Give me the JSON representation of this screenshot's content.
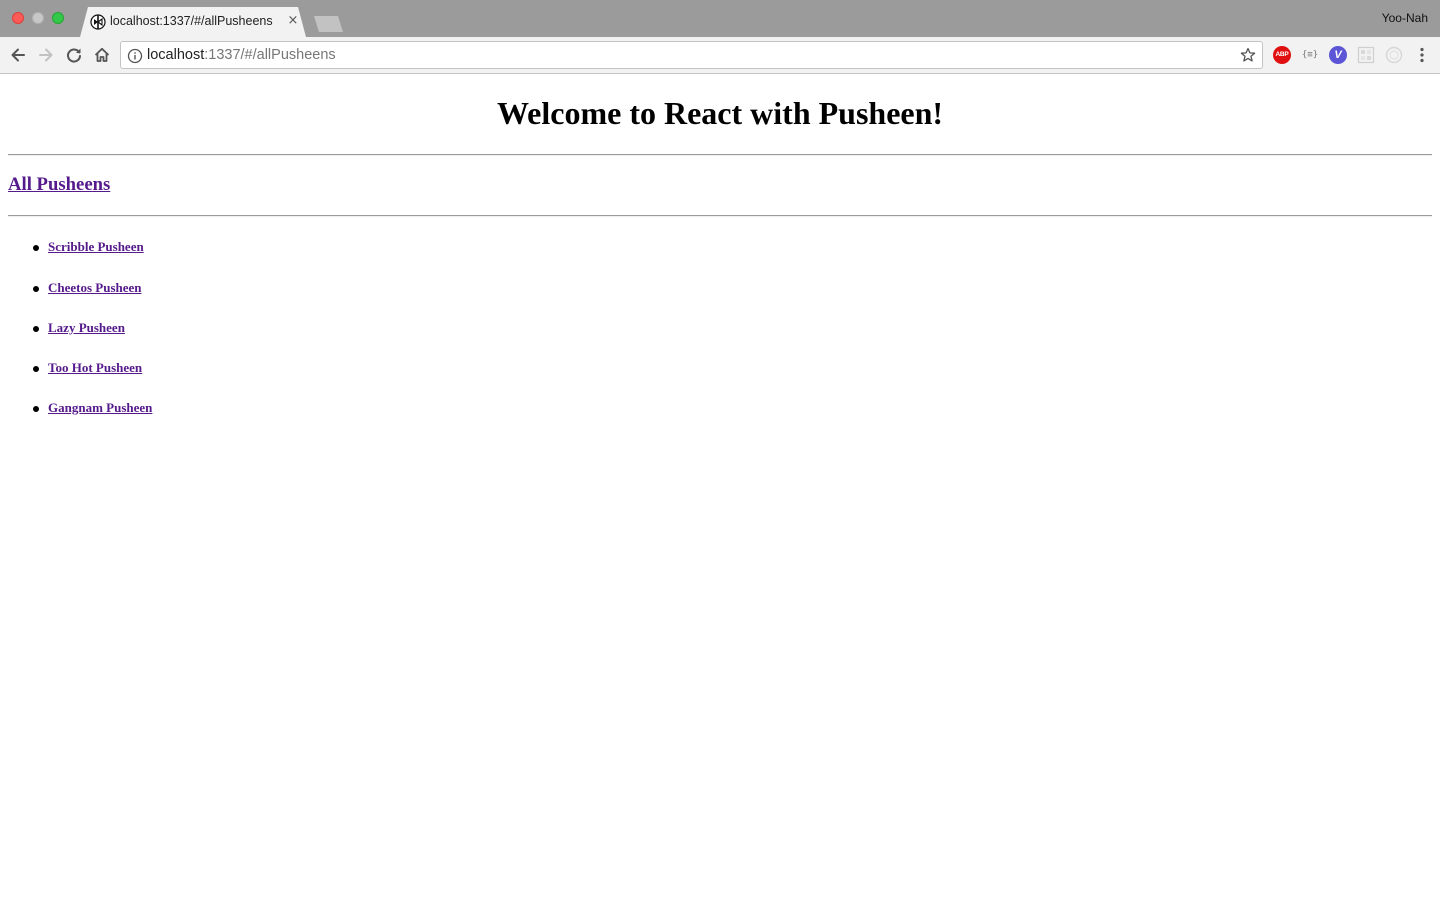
{
  "browser": {
    "tab": {
      "title": "localhost:1337/#/allPusheens",
      "close_symbol": "×",
      "favicon": "react-logo-icon"
    },
    "profile_name": "Yoo-Nah",
    "address_bar": {
      "host": "localhost",
      "path": ":1337/#/allPusheens"
    },
    "extensions": {
      "adblock_label": "ABP",
      "json_label": "{≡}",
      "v_label": "V"
    },
    "icons": [
      "back-icon",
      "forward-icon",
      "reload-icon",
      "home-icon",
      "info-icon",
      "bookmark-star-icon",
      "more-menu-icon"
    ]
  },
  "page": {
    "title": "Welcome to React with Pusheen!",
    "nav_link": "All Pusheens",
    "pusheens": [
      "Scribble Pusheen",
      "Cheetos Pusheen",
      "Lazy Pusheen",
      "Too Hot Pusheen",
      "Gangnam Pusheen"
    ]
  },
  "colors": {
    "link": "#551a8b",
    "chrome_titlebar": "#9b9b9b",
    "chrome_toolbar": "#f2f2f2"
  }
}
